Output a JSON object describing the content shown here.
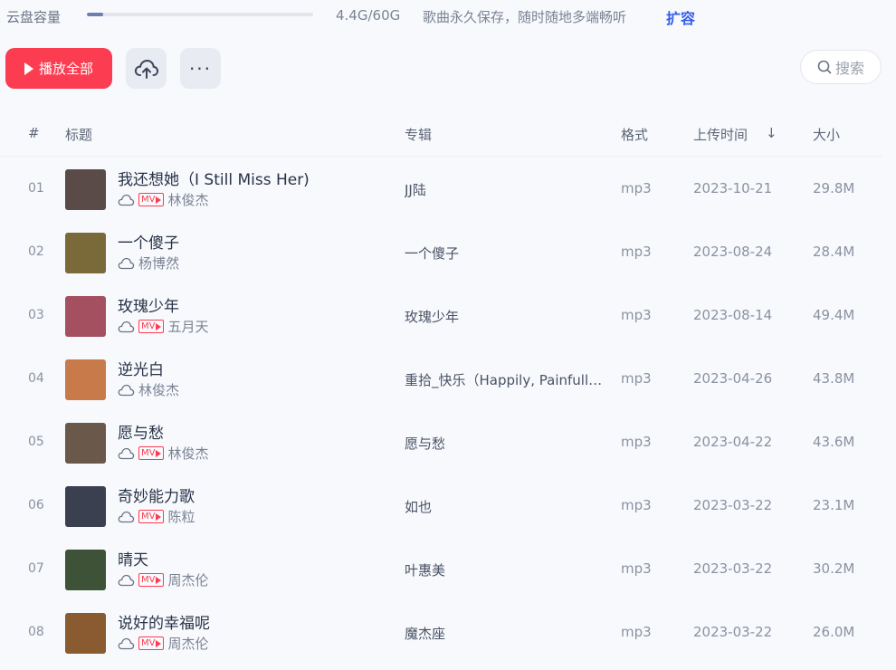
{
  "capacity": {
    "label": "云盘容量",
    "used_text": "4.4G/60G",
    "used_fraction": 0.073,
    "description": "歌曲永久保存，随时随地多端畅听",
    "expand_label": "扩容"
  },
  "toolbar": {
    "play_all_label": "播放全部",
    "upload_icon": "cloud-upload-icon",
    "more_label": "···",
    "search_placeholder": "搜索"
  },
  "table": {
    "columns": {
      "index": "#",
      "title": "标题",
      "album": "专辑",
      "format": "格式",
      "upload_time": "上传时间",
      "sort_arrow": "↓",
      "size": "大小"
    },
    "rows": [
      {
        "index": "01",
        "title": "我还想她（I Still Miss Her)",
        "mv": "MV",
        "artist": "林俊杰",
        "album": "JJ陆",
        "format": "mp3",
        "date": "2023-10-21",
        "size": "29.8M",
        "cover_color": "#5a4a48"
      },
      {
        "index": "02",
        "title": "一个傻子",
        "mv": "",
        "artist": "杨博然",
        "album": "一个傻子",
        "format": "mp3",
        "date": "2023-08-24",
        "size": "28.4M",
        "cover_color": "#7a6a3a"
      },
      {
        "index": "03",
        "title": "玫瑰少年",
        "mv": "MV",
        "artist": "五月天",
        "album": "玫瑰少年",
        "format": "mp3",
        "date": "2023-08-14",
        "size": "49.4M",
        "cover_color": "#a45060"
      },
      {
        "index": "04",
        "title": "逆光白",
        "mv": "",
        "artist": "林俊杰",
        "album": "重拾_快乐（Happily, Painfully After)",
        "format": "mp3",
        "date": "2023-04-26",
        "size": "43.8M",
        "cover_color": "#c87a4a"
      },
      {
        "index": "05",
        "title": "愿与愁",
        "mv": "MV",
        "artist": "林俊杰",
        "album": "愿与愁",
        "format": "mp3",
        "date": "2023-04-22",
        "size": "43.6M",
        "cover_color": "#6a584a"
      },
      {
        "index": "06",
        "title": "奇妙能力歌",
        "mv": "MV",
        "artist": "陈粒",
        "album": "如也",
        "format": "mp3",
        "date": "2023-03-22",
        "size": "23.1M",
        "cover_color": "#3a4050"
      },
      {
        "index": "07",
        "title": "晴天",
        "mv": "MV",
        "artist": "周杰伦",
        "album": "叶惠美",
        "format": "mp3",
        "date": "2023-03-22",
        "size": "30.2M",
        "cover_color": "#3e5238"
      },
      {
        "index": "08",
        "title": "说好的幸福呢",
        "mv": "MV",
        "artist": "周杰伦",
        "album": "魔杰座",
        "format": "mp3",
        "date": "2023-03-22",
        "size": "26.0M",
        "cover_color": "#8a5a30"
      }
    ]
  },
  "colors": {
    "accent_red": "#fc3d51",
    "expand_blue": "#335eea",
    "background": "#f7f9fc"
  }
}
